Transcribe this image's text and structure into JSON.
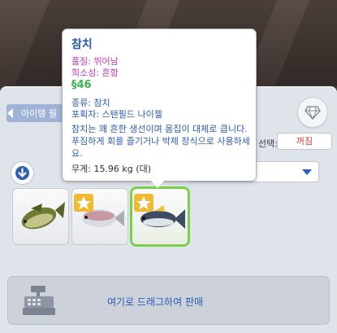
{
  "panel": {
    "filter_tab_label": "아이템 필",
    "toggle_label": "선택:",
    "toggle_value": "꺼짐",
    "sell_label": "여기로 드래그하여 판매"
  },
  "tooltip": {
    "title": "참치",
    "quality": "품질: 뛰어남",
    "rarity": "희소성: 흔함",
    "currency_symbol": "§",
    "price": "46",
    "type": "종류: 참치",
    "catcher": "포획자: 스탠필드 나이젤",
    "description": "참치는 꽤 흔한 생선이며 몸집이 대체로 큽니다. 푸짐하게 회를 즐기거나 박제 장식으로 사용하세요.",
    "weight": "무게: 15.96 kg (대)"
  },
  "inventory": [
    {
      "name": "bass-fish",
      "starred": false,
      "selected": false
    },
    {
      "name": "silver-fish",
      "starred": true,
      "selected": false
    },
    {
      "name": "tuna-fish",
      "starred": true,
      "selected": true
    }
  ],
  "colors": {
    "accent_blue": "#2d5bb5",
    "quality_pink": "#c43cbf",
    "price_green": "#3bb34a",
    "off_red": "#d63a3a",
    "selected_green": "#7bd04a"
  }
}
